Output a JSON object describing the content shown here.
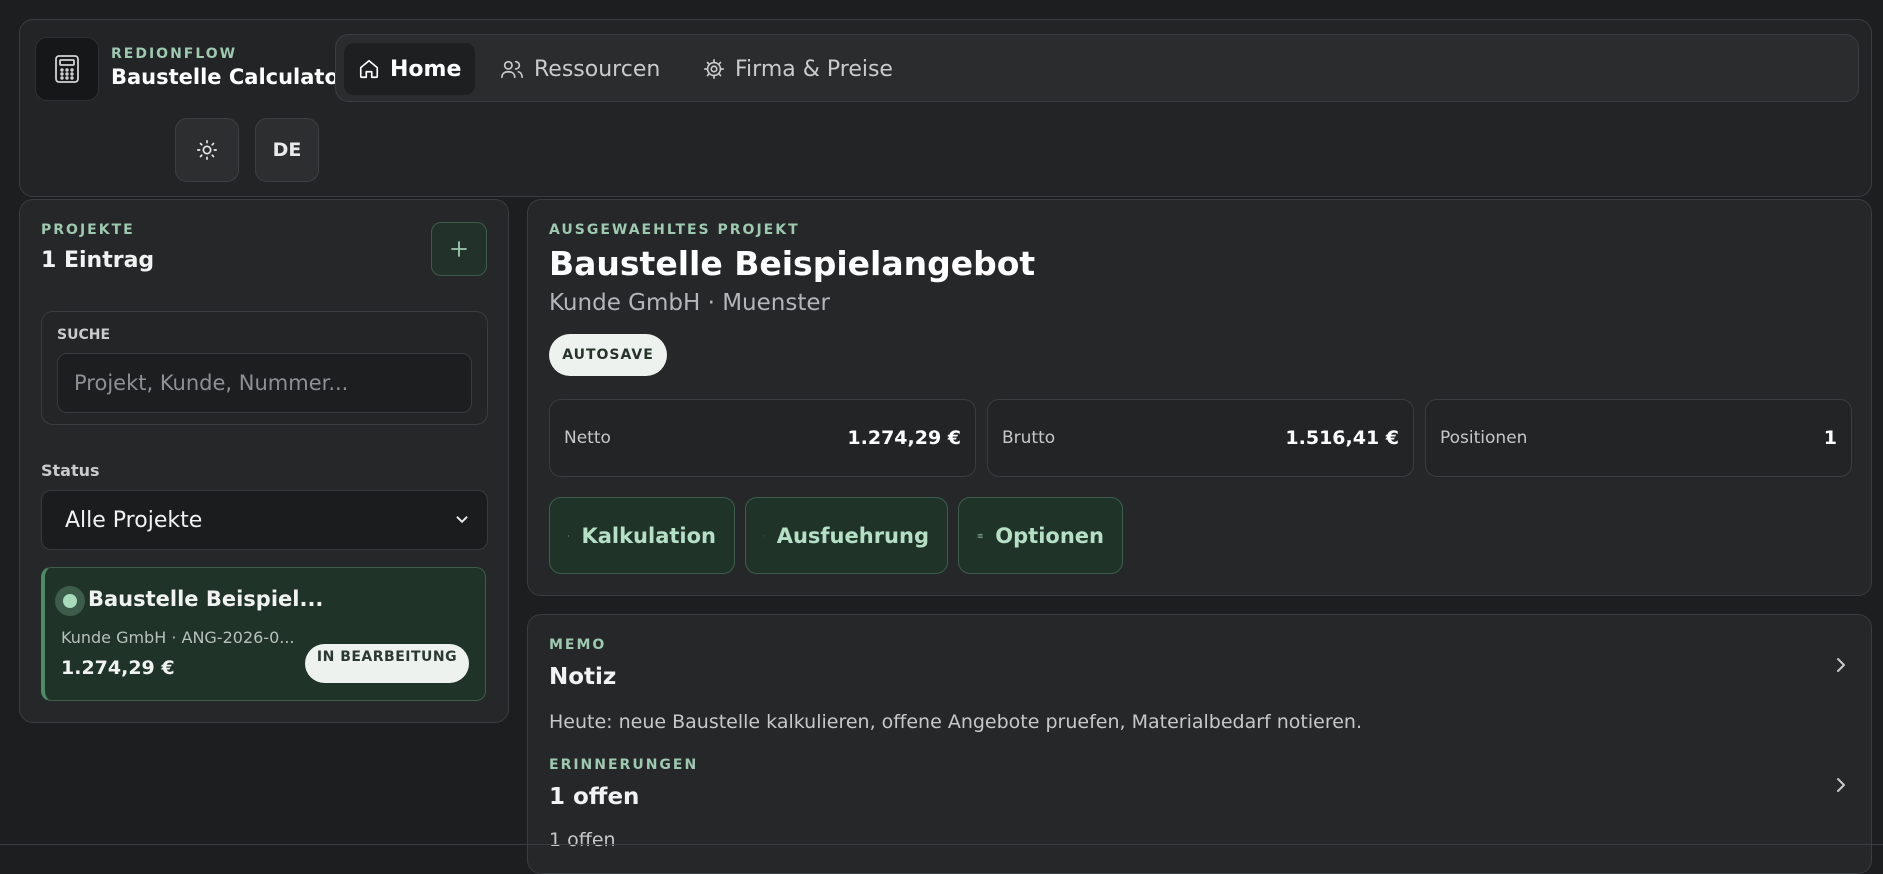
{
  "brand": {
    "eyebrow": "REDIONFLOW",
    "title": "Baustelle Calculator"
  },
  "nav": [
    {
      "label": "Home",
      "icon": "home-icon",
      "active": true
    },
    {
      "label": "Ressourcen",
      "icon": "users-icon",
      "active": false
    },
    {
      "label": "Firma & Preise",
      "icon": "gear-icon",
      "active": false
    }
  ],
  "header_controls": {
    "theme_icon": "sun-icon",
    "language": "DE"
  },
  "sidebar": {
    "eyebrow": "PROJEKTE",
    "count": "1 Eintrag",
    "add_icon": "plus-icon",
    "search": {
      "label": "SUCHE",
      "placeholder": "Projekt, Kunde, Nummer...",
      "value": ""
    },
    "status": {
      "label": "Status",
      "selected": "Alle Projekte"
    },
    "projects": [
      {
        "name": "Baustelle Beispiel...",
        "subtitle": "Kunde GmbH · ANG-2026-0...",
        "price": "1.274,29 €",
        "badge": "IN BEARBEITUNG"
      }
    ]
  },
  "selected_project": {
    "eyebrow": "AUSGEWAEHLTES PROJEKT",
    "title": "Baustelle Beispielangebot",
    "subtitle": "Kunde GmbH · Muenster",
    "autosave": "AUTOSAVE",
    "stats": [
      {
        "label": "Netto",
        "value": "1.274,29 €"
      },
      {
        "label": "Brutto",
        "value": "1.516,41 €"
      },
      {
        "label": "Positionen",
        "value": "1"
      }
    ],
    "actions": [
      {
        "label": "Kalkulation",
        "icon": "document-icon"
      },
      {
        "label": "Ausfuehrung",
        "icon": "clipboard-icon"
      },
      {
        "label": "Optionen",
        "icon": "sliders-icon"
      }
    ]
  },
  "memo": {
    "eyebrow": "MEMO",
    "title": "Notiz",
    "text": "Heute: neue Baustelle kalkulieren, offene Angebote pruefen, Materialbedarf notieren."
  },
  "reminders": {
    "eyebrow": "ERINNERUNGEN",
    "title": "1 offen",
    "text": "1 offen"
  },
  "colors": {
    "background": "#1c1e1f",
    "card": "#252729",
    "accent_green": "#9ec9b1",
    "active_item_bg": "#1f3328",
    "badge_bg": "#edf2ef"
  }
}
